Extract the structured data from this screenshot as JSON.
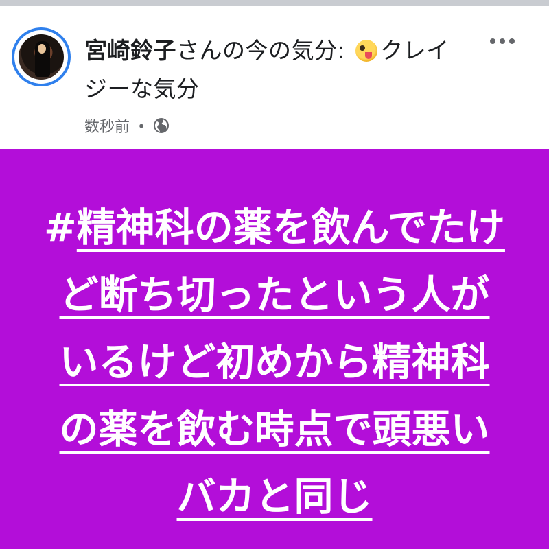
{
  "post": {
    "author": "宮崎鈴子",
    "feeling_text": "さんの今の気分:",
    "feeling_emoji": "crazy-face-emoji",
    "feeling_label": "クレイジーな気分",
    "timestamp": "数秒前",
    "separator": "・",
    "privacy_icon": "globe-icon",
    "more_icon": "more-horizontal-icon"
  },
  "content": {
    "hash_symbol": "#",
    "hashtag_text": "精神科の薬を飲んでたけど断ち切ったという人がいるけど初めから精神科の薬を飲む時点で頭悪いバカと同じ",
    "background_color": "#b30ed9",
    "text_color": "#ffffff"
  },
  "colors": {
    "avatar_ring": "#2f80ed",
    "primary_text": "#1c1e21",
    "secondary_text": "#65676b"
  }
}
